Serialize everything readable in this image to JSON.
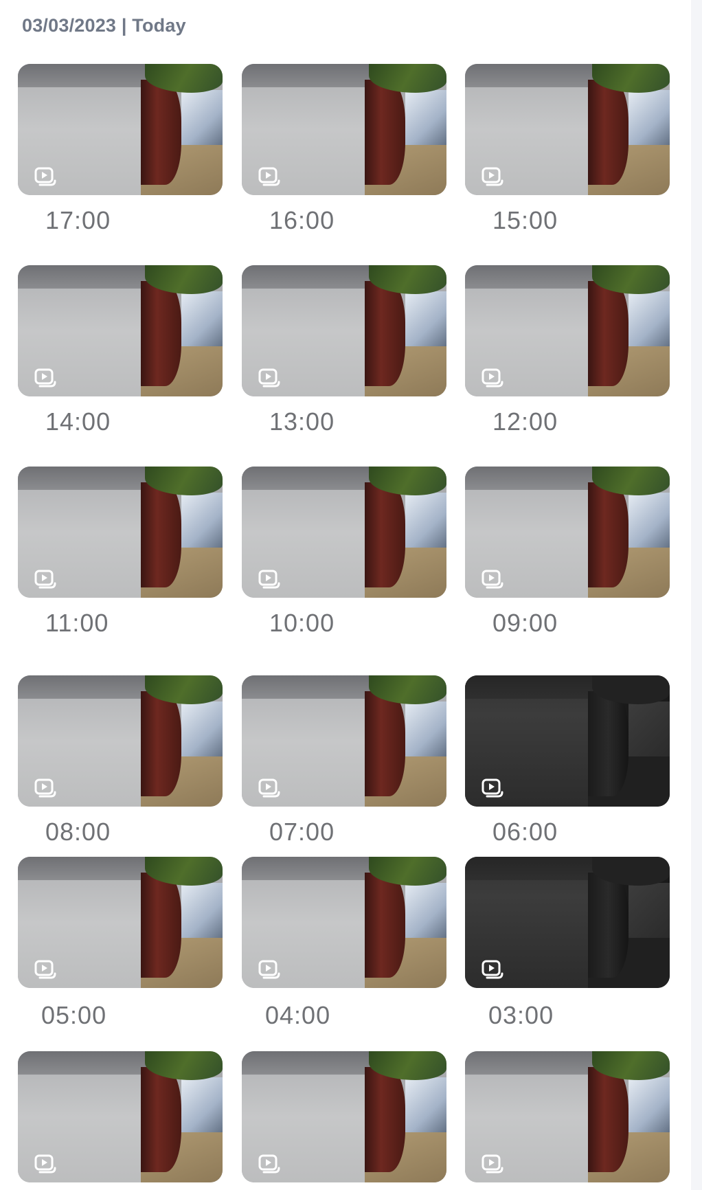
{
  "header": {
    "date_label": "03/03/2023 | Today"
  },
  "recordings": [
    {
      "time": "17:00",
      "mode": "day"
    },
    {
      "time": "16:00",
      "mode": "day"
    },
    {
      "time": "15:00",
      "mode": "day"
    },
    {
      "time": "14:00",
      "mode": "day"
    },
    {
      "time": "13:00",
      "mode": "day"
    },
    {
      "time": "12:00",
      "mode": "day"
    },
    {
      "time": "11:00",
      "mode": "day"
    },
    {
      "time": "10:00",
      "mode": "day"
    },
    {
      "time": "09:00",
      "mode": "day"
    },
    {
      "time": "08:00",
      "mode": "day"
    },
    {
      "time": "07:00",
      "mode": "day"
    },
    {
      "time": "06:00",
      "mode": "night"
    },
    {
      "time": "05:00",
      "mode": "day"
    },
    {
      "time": "04:00",
      "mode": "day"
    },
    {
      "time": "03:00",
      "mode": "night"
    },
    {
      "time": "",
      "mode": "day"
    },
    {
      "time": "",
      "mode": "day"
    },
    {
      "time": "",
      "mode": "day"
    }
  ],
  "icons": {
    "play": "video-play-icon"
  }
}
